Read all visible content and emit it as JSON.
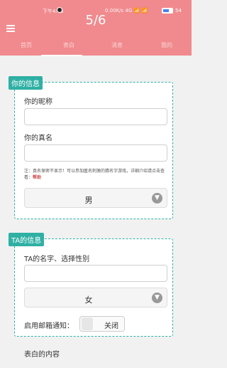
{
  "status_bar": {
    "left_text": "下午4:45",
    "right_text": "0.00K/s 4G 📶 📶",
    "battery_text": "54"
  },
  "header": {
    "page_indicator": "5/6",
    "tabs": [
      "首页",
      "表白",
      "消息",
      "我的"
    ]
  },
  "your_info": {
    "tag": "你的信息",
    "nickname_label": "你的昵称",
    "realname_label": "你的真名",
    "note": "注：真名保密不显示！可以参加匿名刺激的猜名字游戏，详细介绍请点击查看：",
    "note_link": "帮助",
    "gender_value": "男"
  },
  "ta_info": {
    "tag": "TA的信息",
    "name_label": "TA的名字、选择性别",
    "gender_value": "女",
    "email_label": "启用邮箱通知：",
    "toggle_text": "关闭"
  },
  "confession": {
    "label": "表白的内容"
  },
  "colors": {
    "header": "#f08a8e",
    "accent": "#2fb0a4"
  }
}
